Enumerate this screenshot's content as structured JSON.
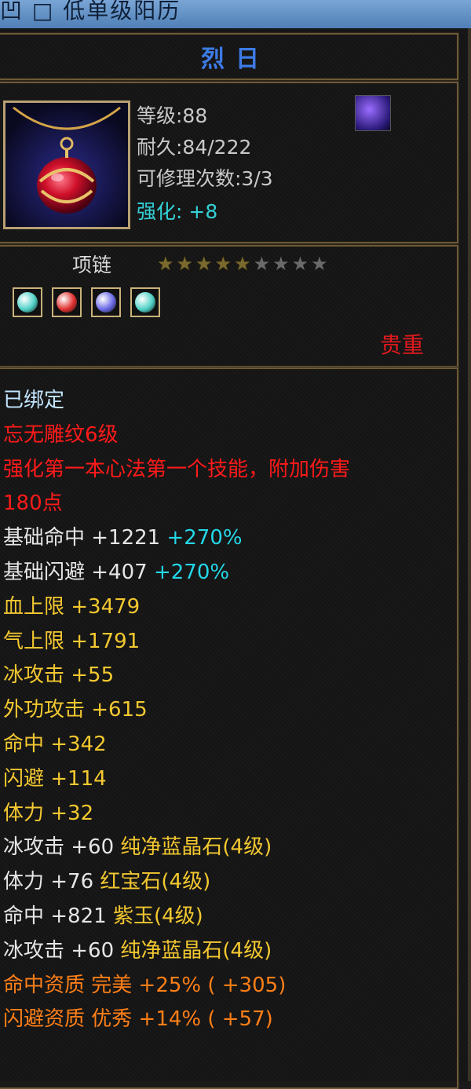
{
  "window": {
    "title": "凹 □ 低单级阳历"
  },
  "item": {
    "name": "烈日",
    "level": "等级:88",
    "durability": "耐久:84/222",
    "repairs": "可修理次数:3/3",
    "enhance": "强化: +8",
    "type": "项链",
    "stars_total": 9,
    "stars_filled": 5,
    "rarity": "贵重",
    "icon_name": "red-pendant-icon",
    "gem_icon_name": "purple-gem-icon"
  },
  "sockets": [
    {
      "name": "cyan-gem-icon",
      "color": "#4fd1c7"
    },
    {
      "name": "red-gem-icon",
      "color": "#e03030"
    },
    {
      "name": "purple-gem-icon",
      "color": "#6a6ae6"
    },
    {
      "name": "cyan-gem-icon",
      "color": "#4fd1c7"
    }
  ],
  "lines": [
    {
      "parts": [
        {
          "t": "已绑定",
          "c": "c-cyan"
        }
      ]
    },
    {
      "parts": [
        {
          "t": "忘无雕纹6级",
          "c": "c-red"
        }
      ]
    },
    {
      "parts": [
        {
          "t": "强化第一本心法第一个技能，附加伤害",
          "c": "c-red"
        }
      ]
    },
    {
      "parts": [
        {
          "t": "180点",
          "c": "c-red"
        }
      ]
    },
    {
      "parts": [
        {
          "t": "基础命中 +1221 ",
          "c": "c-white"
        },
        {
          "t": "+270%",
          "c": "c-aqua"
        }
      ]
    },
    {
      "parts": [
        {
          "t": "基础闪避 +407 ",
          "c": "c-white"
        },
        {
          "t": "+270%",
          "c": "c-aqua"
        }
      ]
    },
    {
      "parts": [
        {
          "t": "血上限 +3479",
          "c": "c-yellow"
        }
      ]
    },
    {
      "parts": [
        {
          "t": "气上限 +1791",
          "c": "c-yellow"
        }
      ]
    },
    {
      "parts": [
        {
          "t": "冰攻击 +55",
          "c": "c-yellow"
        }
      ]
    },
    {
      "parts": [
        {
          "t": "外功攻击 +615",
          "c": "c-yellow"
        }
      ]
    },
    {
      "parts": [
        {
          "t": "命中 +342",
          "c": "c-yellow"
        }
      ]
    },
    {
      "parts": [
        {
          "t": "闪避 +114",
          "c": "c-yellow"
        }
      ]
    },
    {
      "parts": [
        {
          "t": "体力 +32",
          "c": "c-yellow"
        }
      ]
    },
    {
      "parts": [
        {
          "t": "冰攻击 +60 ",
          "c": "c-white"
        },
        {
          "t": "纯净蓝晶石(4级)",
          "c": "c-yellow"
        }
      ]
    },
    {
      "parts": [
        {
          "t": "体力 +76 ",
          "c": "c-white"
        },
        {
          "t": "红宝石(4级)",
          "c": "c-yellow"
        }
      ]
    },
    {
      "parts": [
        {
          "t": "命中 +821 ",
          "c": "c-white"
        },
        {
          "t": "紫玉(4级)",
          "c": "c-yellow"
        }
      ]
    },
    {
      "parts": [
        {
          "t": "冰攻击 +60 ",
          "c": "c-white"
        },
        {
          "t": "纯净蓝晶石(4级)",
          "c": "c-yellow"
        }
      ]
    },
    {
      "parts": [
        {
          "t": "命中资质  完美 +25% ( +305)",
          "c": "c-orange"
        }
      ]
    },
    {
      "parts": [
        {
          "t": "闪避资质  优秀 +14% ( +57)",
          "c": "c-orange"
        }
      ]
    }
  ]
}
